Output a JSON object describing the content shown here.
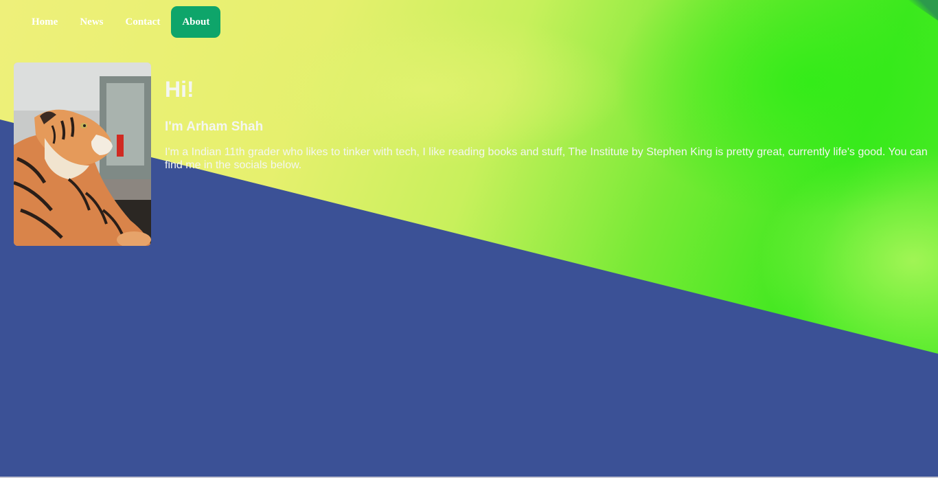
{
  "nav": {
    "items": [
      {
        "label": "Home",
        "active": false
      },
      {
        "label": "News",
        "active": false
      },
      {
        "label": "Contact",
        "active": false
      },
      {
        "label": "About",
        "active": true
      }
    ]
  },
  "profile": {
    "image_alt": "tiger plush toy photo",
    "greeting": "Hi!",
    "name": "I'm Arham Shah",
    "bio": "I'm a Indian 11th grader who likes to tinker with tech, I like reading books and stuff, The Institute by Stephen King is pretty great, currently life's good. You can find me in the socials below."
  },
  "colors": {
    "background": "#3b5196",
    "active_nav": "#0ea56a",
    "text": "#f4f6f2"
  }
}
